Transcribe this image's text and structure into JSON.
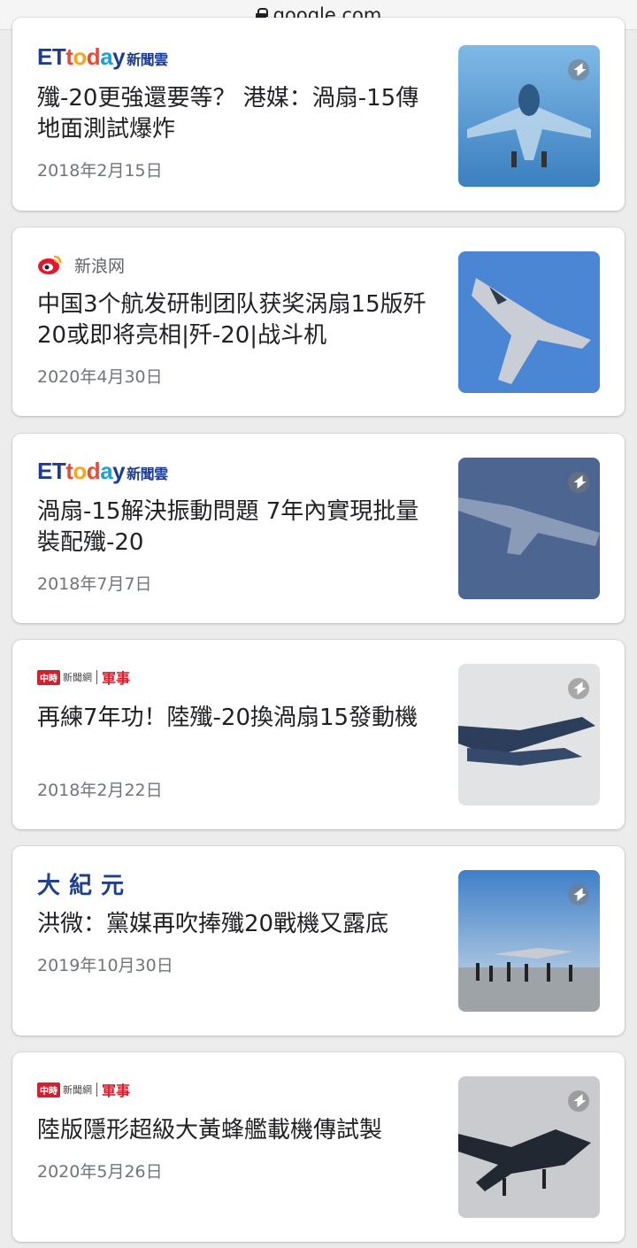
{
  "browser": {
    "url": "google.com"
  },
  "articles": [
    {
      "source": "ETtoday新聞雲",
      "title": "殲-20更強還要等？ 港媒：渦扇-15傳地面測試爆炸",
      "date": "2018年2月15日"
    },
    {
      "source": "新浪网",
      "title": "中国3个航发研制团队获奖涡扇15版歼20或即将亮相|歼-20|战斗机",
      "date": "2020年4月30日"
    },
    {
      "source": "ETtoday新聞雲",
      "title": "渦扇-15解決振動問題 7年內實現批量裝配殲-20",
      "date": "2018年7月7日"
    },
    {
      "source": "中時新聞網 軍事",
      "title": "再練7年功！陸殲-20換渦扇15發動機",
      "date": "2018年2月22日"
    },
    {
      "source": "大紀元",
      "title": "洪微：黨媒再吹捧殲20戰機又露底",
      "date": "2019年10月30日"
    },
    {
      "source": "中時新聞網 軍事",
      "title": "陸版隱形超級大黃蜂艦載機傳試製",
      "date": "2020年5月26日"
    }
  ],
  "logos": {
    "ettoday": {
      "et": "ET",
      "t": "t",
      "o": "o",
      "d": "d",
      "a": "a",
      "y": "y",
      "cn": "新聞雲"
    },
    "sina": {
      "text": "新浪网"
    },
    "chinatimes": {
      "box": "中時",
      "net": "新聞網",
      "section": "軍事"
    },
    "epoch": {
      "text": "大紀元"
    }
  },
  "icons": {
    "amp": "amp-lightning-icon",
    "lock": "lock-icon"
  }
}
